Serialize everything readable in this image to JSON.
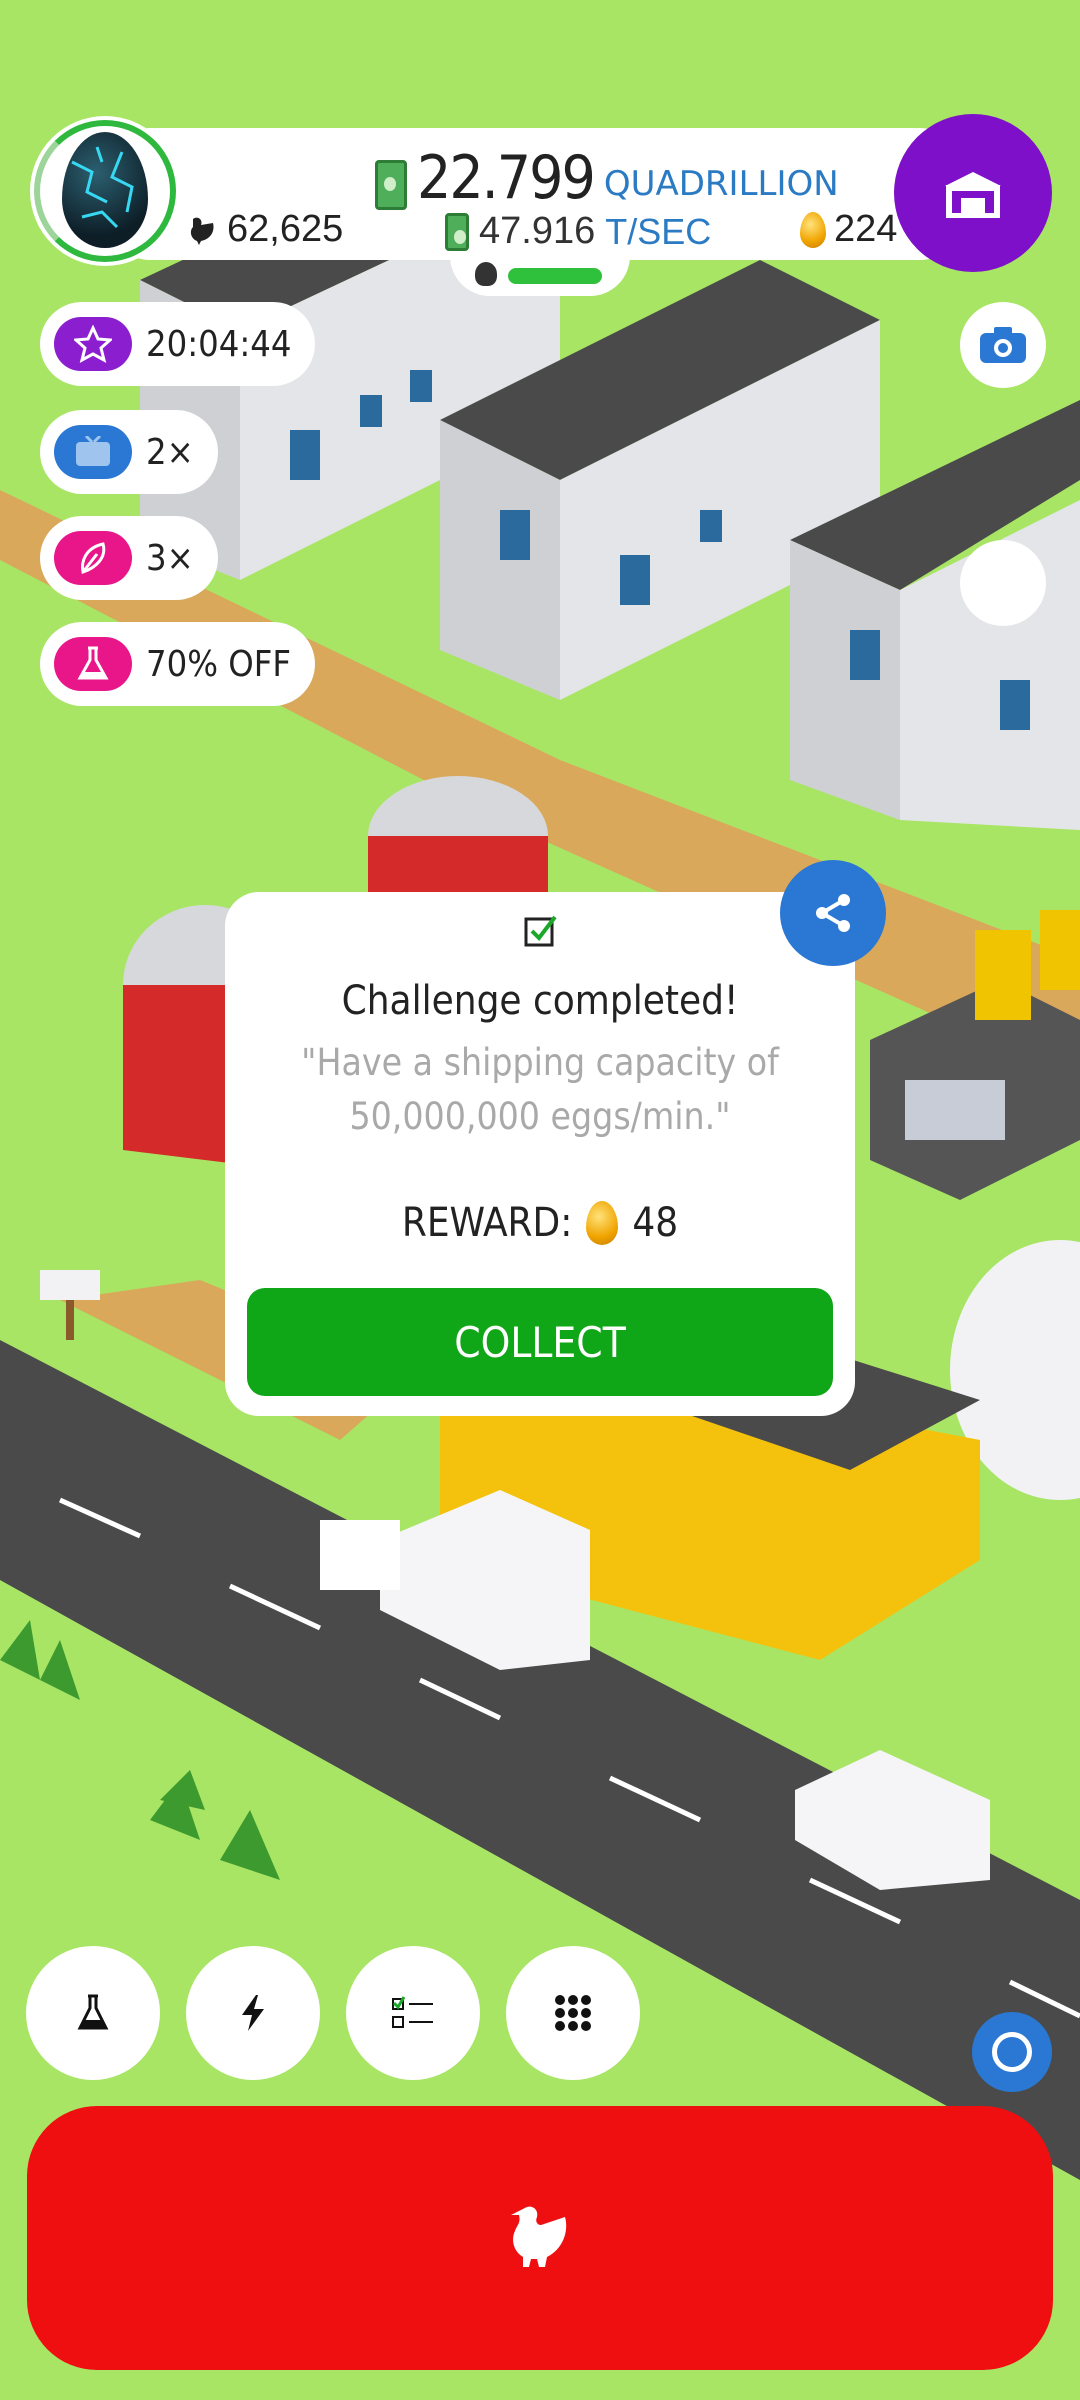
{
  "header": {
    "money_value": "22.799",
    "money_unit": "QUADRILLION",
    "rate_value": "47.916",
    "rate_unit": "T/SEC",
    "chickens": "62,625",
    "eggs": "224"
  },
  "boosts": [
    {
      "icon": "star-icon",
      "text": "20:04:44",
      "color": "#8b1fd0"
    },
    {
      "icon": "tv-icon",
      "text": "2×",
      "color": "#2a78d4"
    },
    {
      "icon": "feather-icon",
      "text": "3×",
      "color": "#e9168a"
    },
    {
      "icon": "flask-icon",
      "text": "70% OFF",
      "color": "#e9168a"
    }
  ],
  "dialog": {
    "title": "Challenge completed!",
    "description": "\"Have a shipping capacity of 50,000,000 eggs/min.\"",
    "reward_label": "REWARD:",
    "reward_value": "48",
    "collect_label": "COLLECT"
  },
  "bottom_buttons": [
    {
      "icon": "flask-icon"
    },
    {
      "icon": "lightning-icon"
    },
    {
      "icon": "checklist-icon"
    },
    {
      "icon": "grid-icon"
    }
  ],
  "colors": {
    "grass": "#a8e565",
    "store": "#7d10c8",
    "collect": "#0fa617",
    "hatch": "#ef0e10",
    "accent_blue": "#2a78d4"
  }
}
